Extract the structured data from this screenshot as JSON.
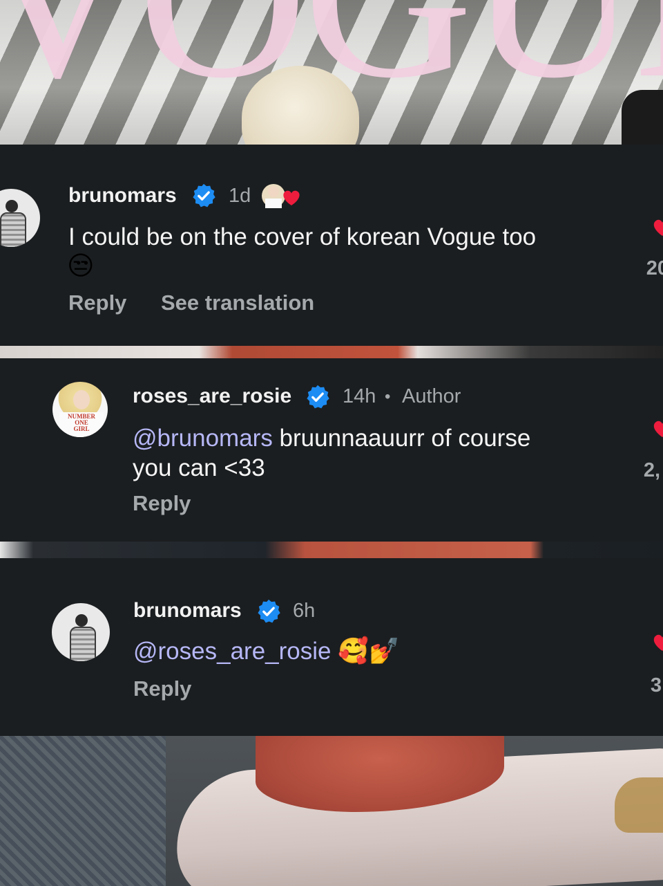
{
  "background": {
    "logo_text": "VOGUE"
  },
  "comments": [
    {
      "username": "brunomars",
      "verified": true,
      "time": "1d",
      "text": "I could be on the cover of korean Vogue too",
      "emoji": "😒",
      "actions": {
        "reply": "Reply",
        "translate": "See translation"
      },
      "like_count": "20",
      "author_liked": true
    },
    {
      "username": "roses_are_rosie",
      "verified": true,
      "time": "14h",
      "author_label": "Author",
      "mention": "@brunomars",
      "text_line1": " bruunnaauurr of course",
      "text_line2": "you can <33",
      "avatar_shirt": [
        "NUMBER",
        "ONE",
        "GIRL"
      ],
      "actions": {
        "reply": "Reply"
      },
      "like_count": "2,"
    },
    {
      "username": "brunomars",
      "verified": true,
      "time": "6h",
      "mention": "@roses_are_rosie",
      "emojis": "🥰💅",
      "actions": {
        "reply": "Reply"
      },
      "like_count": "3"
    }
  ],
  "colors": {
    "panel_bg": "#1b1e20",
    "verified_blue": "#1d8cf3",
    "mention": "#b6b7f6",
    "heart_red": "#ee1d3e"
  },
  "icons": [
    "verified-badge-icon",
    "heart-icon",
    "author-liked-badge-icon"
  ]
}
